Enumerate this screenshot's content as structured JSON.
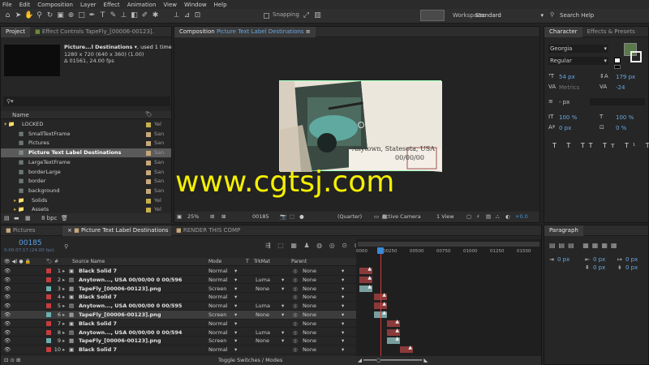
{
  "menu": [
    "File",
    "Edit",
    "Composition",
    "Layer",
    "Effect",
    "Animation",
    "View",
    "Window",
    "Help"
  ],
  "toolbar": {
    "snapping": "Snapping",
    "workspace_label": "Workspace:",
    "workspace_value": "Standard",
    "search_placeholder": "Search Help"
  },
  "project": {
    "tab": "Project",
    "effect_tab": "Effect Controls TapeFly_[00006-00123].",
    "preview_name": "Picture...l Destinations ▾",
    "used": ", used 1 time",
    "dims": "1280 x 720  (640 x 360) (1.00)",
    "duration": "Δ 01561, 24.00 fps",
    "col_name": "Name",
    "items": [
      {
        "label": "LOCKED",
        "type": "folder",
        "tag": "Yel",
        "color": "#c8b04a",
        "selected": false
      },
      {
        "label": "SmallTextFrame",
        "type": "comp",
        "tag": "San",
        "color": "#c8a878",
        "selected": false
      },
      {
        "label": "Pictures",
        "type": "comp",
        "tag": "San",
        "color": "#c8a878",
        "selected": false
      },
      {
        "label": "Picture Text Label Destinations",
        "type": "comp",
        "tag": "San",
        "color": "#c8a878",
        "selected": true
      },
      {
        "label": "LargeTextFrame",
        "type": "comp",
        "tag": "San",
        "color": "#c8a878",
        "selected": false
      },
      {
        "label": "borderLarge",
        "type": "comp",
        "tag": "San",
        "color": "#c8a878",
        "selected": false
      },
      {
        "label": "border",
        "type": "comp",
        "tag": "San",
        "color": "#c8a878",
        "selected": false
      },
      {
        "label": "background",
        "type": "comp",
        "tag": "San",
        "color": "#c8a878",
        "selected": false
      },
      {
        "label": "Solids",
        "type": "folder",
        "tag": "Yel",
        "color": "#c8b04a",
        "selected": false
      },
      {
        "label": "Assets",
        "type": "folder",
        "tag": "Yel",
        "color": "#c8b04a",
        "selected": false
      }
    ],
    "bpc": "8 bpc"
  },
  "composition": {
    "tab_prefix": "Composition",
    "tab_name": "Picture Text Label Destinations",
    "label_line1": "Anytown, Statesota, USA",
    "label_line2": "00/00/00",
    "zoom": "25%",
    "timecode": "00185",
    "quality": "(Quarter)",
    "camera": "Active Camera",
    "view": "1 View",
    "offset": "+0.0"
  },
  "watermark": "www.cgtsj.com",
  "character": {
    "tab": "Character",
    "tab2": "Effects & Presets",
    "font": "Georgia",
    "style": "Regular",
    "size": "54 px",
    "leading": "179 px",
    "kerning": "Metrics",
    "tracking": "-24",
    "stroke": "- px",
    "vscale": "100 %",
    "hscale": "100 %",
    "baseline": "0 px",
    "tsume": "0 %",
    "fill_color": "#5a7a4a",
    "stroke_color": "#f0f0f0"
  },
  "paragraph": {
    "tab": "Paragraph",
    "indent1": "0 px",
    "indent2": "0 px",
    "indent3": "0 px",
    "space1": "0 px",
    "space2": "0 px"
  },
  "bottom_tabs": {
    "pictures": "Pictures",
    "active": "Picture Text Label Destinations",
    "render": "RENDER THIS COMP"
  },
  "timeline": {
    "timecode": "00185",
    "sub": "0:00:07:17 (24.00 fps)",
    "cols": {
      "source": "Source Name",
      "mode": "Mode",
      "t": "T",
      "trkmat": "TrkMat",
      "parent": "Parent"
    },
    "rulers": [
      "0000",
      "00250",
      "00500",
      "00750",
      "01000",
      "01250",
      "01500"
    ],
    "toggle": "Toggle Switches / Modes",
    "layers": [
      {
        "num": "1",
        "color": "#c83c3c",
        "name": "Black Solid 7",
        "icon": "solid",
        "mode": "Normal",
        "trk": "",
        "parent": "None",
        "bar": "#8a3a3a",
        "start": 0.0
      },
      {
        "num": "2",
        "color": "#c83c3c",
        "name": "Anytown..., USA 00/00/00 0 00/596",
        "icon": "text",
        "mode": "Normal",
        "trk": "Luma",
        "parent": "None",
        "bar": "#8a3a3a",
        "start": 0.0
      },
      {
        "num": "3",
        "color": "#6ab0b0",
        "name": "TapeFly_[00006-00123].png",
        "icon": "seq",
        "mode": "Screen",
        "trk": "None",
        "parent": "None",
        "bar": "#7a9e9e",
        "start": 0.0
      },
      {
        "num": "4",
        "color": "#c83c3c",
        "name": "Black Solid 7",
        "icon": "solid",
        "mode": "Normal",
        "trk": "",
        "parent": "None",
        "bar": "#8a3a3a",
        "start": 0.09
      },
      {
        "num": "5",
        "color": "#c83c3c",
        "name": "Anytown..., USA 00/00/00 0 00/595",
        "icon": "text",
        "mode": "Normal",
        "trk": "Luma",
        "parent": "None",
        "bar": "#8a3a3a",
        "start": 0.09
      },
      {
        "num": "6",
        "color": "#6ab0b0",
        "name": "TapeFly_[00006-00123].png",
        "icon": "seq",
        "mode": "Screen",
        "trk": "None",
        "parent": "None",
        "bar": "#7a9e9e",
        "start": 0.09
      },
      {
        "num": "7",
        "color": "#c83c3c",
        "name": "Black Solid 7",
        "icon": "solid",
        "mode": "Normal",
        "trk": "",
        "parent": "None",
        "bar": "#8a3a3a",
        "start": 0.17
      },
      {
        "num": "8",
        "color": "#c83c3c",
        "name": "Anytown..., USA 00/00/00 0 00/594",
        "icon": "text",
        "mode": "Normal",
        "trk": "Luma",
        "parent": "None",
        "bar": "#8a3a3a",
        "start": 0.17
      },
      {
        "num": "9",
        "color": "#6ab0b0",
        "name": "TapeFly_[00006-00123].png",
        "icon": "seq",
        "mode": "Screen",
        "trk": "None",
        "parent": "None",
        "bar": "#7a9e9e",
        "start": 0.17
      },
      {
        "num": "10",
        "color": "#c83c3c",
        "name": "Black Solid 7",
        "icon": "solid",
        "mode": "Normal",
        "trk": "",
        "parent": "None",
        "bar": "#8a3a3a",
        "start": 0.25
      }
    ]
  }
}
